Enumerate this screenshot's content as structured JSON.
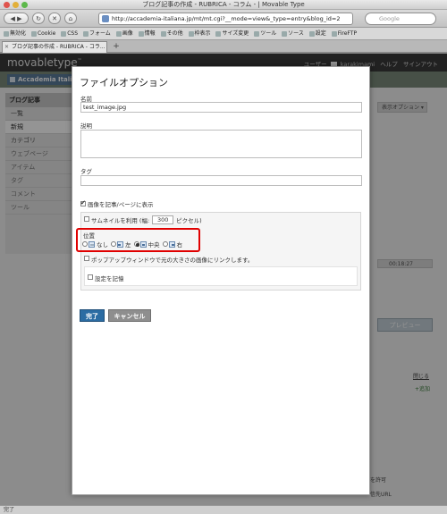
{
  "window": {
    "title": "ブログ記事の作成 - RUBRICA - コラム - | Movable Type",
    "url": "http://accademia-italiana.jp/mt/mt.cgi?__mode=view&_type=entry&blog_id=2",
    "search_placeholder": "Google",
    "tab_title": "ブログ記事の作成 - RUBRICA - コラ...",
    "status": "完了"
  },
  "bookmarks": [
    "無効化",
    "Cookie",
    "CSS",
    "フォーム",
    "画像",
    "情報",
    "その他",
    "枠表示",
    "サイズ変更",
    "ツール",
    "ソース",
    "設定",
    "FireFTP"
  ],
  "mt": {
    "logo": "movabletype",
    "user_label": "ユーザー",
    "username": "karakimami",
    "help": "ヘルプ",
    "signout": "サインアウト",
    "blog_name": "Accademia Italian",
    "sidebar": {
      "header": "ブログ記事",
      "items": [
        "一覧",
        "新規",
        "カテゴリ",
        "ウェブページ",
        "アイテム",
        "タグ",
        "コメント",
        "ツール"
      ]
    },
    "right": {
      "display_options": "表示オプション",
      "time": "00:18:27",
      "preview": "プレビュー",
      "close": "閉じる",
      "add": "追加",
      "allow": "を許可",
      "url_text": "信先URL"
    }
  },
  "modal": {
    "title": "ファイルオプション",
    "name_label": "名前",
    "name_value": "test_image.jpg",
    "description_label": "説明",
    "tags_label": "タグ",
    "show_image_label": "画像を記事/ページに表示",
    "show_image_checked": true,
    "thumbnail_label": "サムネイルを利用 (幅:",
    "thumbnail_width": "300",
    "thumbnail_unit": "ピクセル)",
    "thumbnail_checked": false,
    "position_label": "位置",
    "positions": [
      {
        "label": "なし",
        "selected": false
      },
      {
        "label": "左",
        "selected": false
      },
      {
        "label": "中央",
        "selected": true
      },
      {
        "label": "右",
        "selected": false
      }
    ],
    "popup_label": "ポップアップウィンドウで元の大きさの画像にリンクします。",
    "remember_label": "設定を記憶",
    "ok_button": "完了",
    "cancel_button": "キャンセル"
  },
  "colors": {
    "primary_button": "#2b6ca3",
    "highlight": "#e00000"
  }
}
